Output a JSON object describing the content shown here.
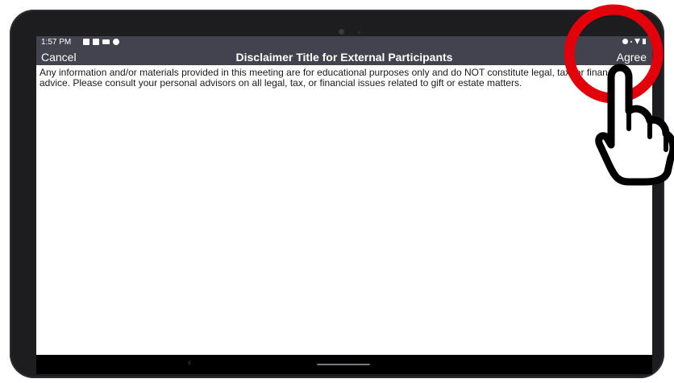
{
  "status_bar": {
    "time": "1:57 PM"
  },
  "app_bar": {
    "cancel_label": "Cancel",
    "title": "Disclaimer Title for External Participants",
    "agree_label": "Agree"
  },
  "content": {
    "body": "Any information and/or materials provided in this meeting are for educational purposes only and do NOT constitute legal, tax, or financial advice. Please consult your personal advisors on all legal, tax, or financial issues related to gift or estate matters."
  },
  "annotation": {
    "highlight_color": "#e3000b",
    "icon": "pointing-hand-icon"
  }
}
